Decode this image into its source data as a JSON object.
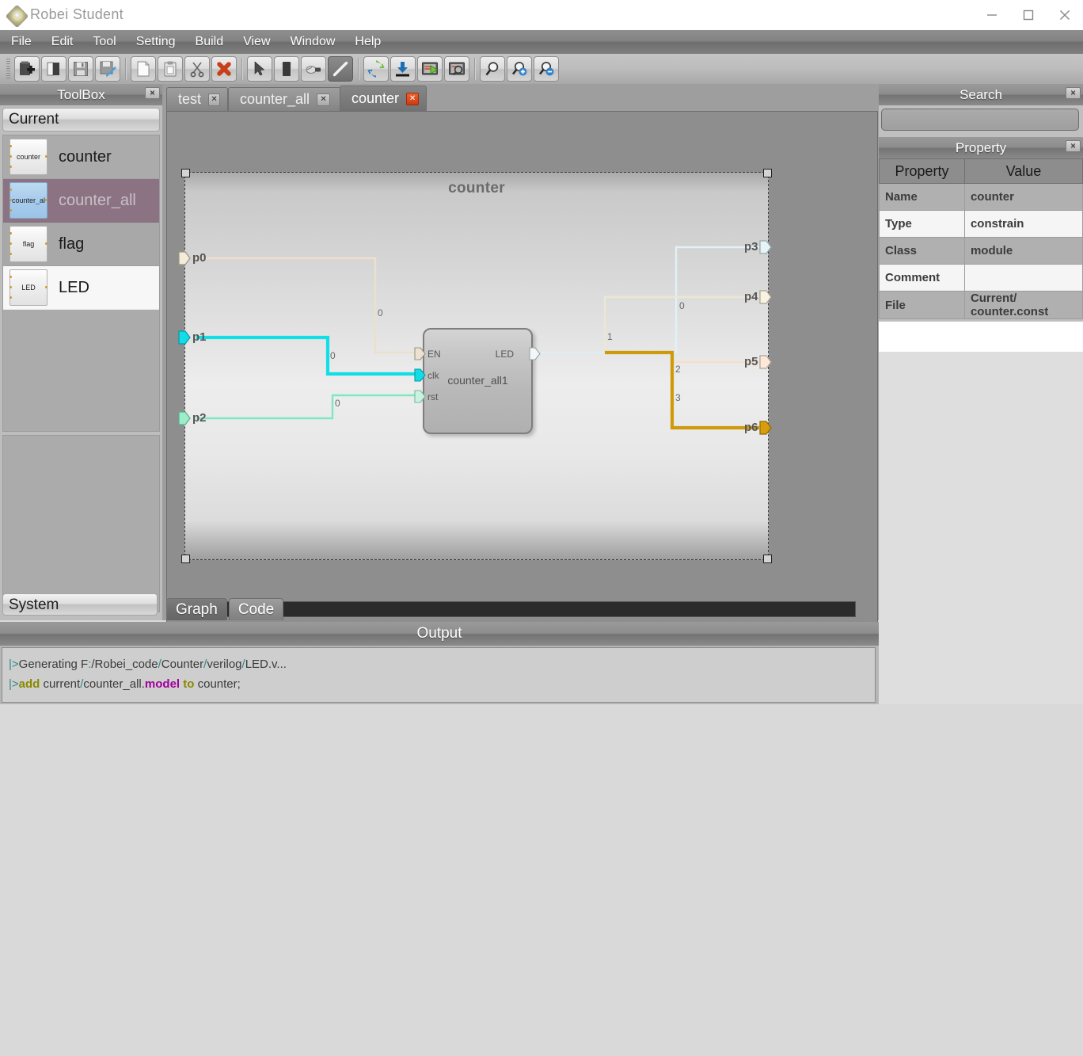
{
  "window": {
    "title": "Robei  Student",
    "app_icon": "robei-logo-icon",
    "minimize": "minimize-icon",
    "maximize": "maximize-icon",
    "close": "close-icon"
  },
  "menubar": {
    "items": [
      "File",
      "Edit",
      "Tool",
      "Setting",
      "Build",
      "View",
      "Window",
      "Help"
    ]
  },
  "toolbar": {
    "groups": [
      {
        "buttons": [
          {
            "name": "new-project-icon",
            "title": "New"
          },
          {
            "name": "open-book-icon",
            "title": "Open"
          },
          {
            "name": "save-icon",
            "title": "Save"
          },
          {
            "name": "save-as-icon",
            "title": "Save As"
          }
        ]
      },
      {
        "buttons": [
          {
            "name": "copy-page-icon",
            "title": "Copy"
          },
          {
            "name": "paste-clipboard-icon",
            "title": "Paste"
          },
          {
            "name": "cut-scissors-icon",
            "title": "Cut"
          },
          {
            "name": "delete-x-icon",
            "title": "Delete"
          }
        ]
      },
      {
        "buttons": [
          {
            "name": "select-arrow-icon",
            "title": "Select"
          },
          {
            "name": "module-icon",
            "title": "Module"
          },
          {
            "name": "port-plug-icon",
            "title": "Port"
          },
          {
            "name": "wire-pen-icon",
            "title": "Wire",
            "active": true
          }
        ]
      },
      {
        "buttons": [
          {
            "name": "compile-refresh-icon",
            "title": "Compile"
          },
          {
            "name": "download-icon",
            "title": "Download"
          },
          {
            "name": "run-simulation-icon",
            "title": "Run"
          },
          {
            "name": "inspect-waveform-icon",
            "title": "Inspect"
          }
        ]
      },
      {
        "buttons": [
          {
            "name": "zoom-fit-icon",
            "title": "Zoom Fit"
          },
          {
            "name": "zoom-in-icon",
            "title": "Zoom In"
          },
          {
            "name": "zoom-out-icon",
            "title": "Zoom Out"
          }
        ]
      }
    ]
  },
  "toolbox": {
    "title": "ToolBox",
    "close_icon": "close-icon",
    "group_current": "Current",
    "group_system": "System",
    "items": [
      {
        "chip": "counter",
        "label": "counter",
        "state": "normal"
      },
      {
        "chip": "counter_al",
        "label": "counter_all",
        "state": "selected"
      },
      {
        "chip": "flag",
        "label": "flag",
        "state": "normal"
      },
      {
        "chip": "LED",
        "label": "LED",
        "state": "white"
      }
    ]
  },
  "editor": {
    "tabs": [
      {
        "label": "test",
        "active": false,
        "close_icon": "close-icon"
      },
      {
        "label": "counter_all",
        "active": false,
        "close_icon": "close-icon"
      },
      {
        "label": "counter",
        "active": true,
        "close_icon": "close-icon"
      }
    ],
    "bottom_tabs": [
      {
        "label": "Graph",
        "active": true
      },
      {
        "label": "Code",
        "active": false
      }
    ]
  },
  "schematic": {
    "module_title": "counter",
    "block": {
      "name": "counter_all1",
      "inputs": [
        {
          "label": "EN",
          "color": "#e8dfcf"
        },
        {
          "label": "clk",
          "color": "#1fd8e0"
        },
        {
          "label": "rst",
          "color": "#bdf0dd"
        }
      ],
      "outputs": [
        {
          "label": "LED",
          "color": "#eef4f4"
        }
      ]
    },
    "input_ports": [
      {
        "label": "p0",
        "color": "#f2e9d8",
        "wire_label": "0"
      },
      {
        "label": "p1",
        "color": "#12e2ea",
        "wire_label": "0"
      },
      {
        "label": "p2",
        "color": "#9aeec9",
        "wire_label": "0"
      }
    ],
    "output_ports": [
      {
        "label": "p3",
        "color": "#e8f4f6",
        "wire_label": "0"
      },
      {
        "label": "p4",
        "color": "#f6f1e0",
        "wire_label": "1"
      },
      {
        "label": "p5",
        "color": "#fbe7d8",
        "wire_label": "2"
      },
      {
        "label": "p6",
        "color": "#d59a0c",
        "wire_label": "3"
      }
    ]
  },
  "search": {
    "title": "Search",
    "close_icon": "close-icon",
    "value": "",
    "placeholder": ""
  },
  "property": {
    "title": "Property",
    "close_icon": "close-icon",
    "headers": [
      "Property",
      "Value"
    ],
    "rows": [
      {
        "key": "Name",
        "value": "counter"
      },
      {
        "key": "Type",
        "value": "constrain"
      },
      {
        "key": "Class",
        "value": "module"
      },
      {
        "key": "Comment",
        "value": ""
      },
      {
        "key": "File",
        "value": "Current/ counter.const"
      }
    ]
  },
  "output": {
    "title": "Output",
    "lines": [
      [
        {
          "t": "|>",
          "c": "c-pipe"
        },
        {
          "t": "Generating F",
          "c": "c-plain"
        },
        {
          "t": ":",
          "c": "c-path"
        },
        {
          "t": "/Robei_code",
          "c": "c-plain"
        },
        {
          "t": "/",
          "c": "c-path"
        },
        {
          "t": "Counter",
          "c": "c-plain"
        },
        {
          "t": "/",
          "c": "c-path"
        },
        {
          "t": "verilog",
          "c": "c-plain"
        },
        {
          "t": "/",
          "c": "c-path"
        },
        {
          "t": "LED.v...",
          "c": "c-plain"
        }
      ],
      [
        {
          "t": "|>",
          "c": "c-pipe"
        },
        {
          "t": "add",
          "c": "c-key"
        },
        {
          "t": " current",
          "c": "c-plain"
        },
        {
          "t": "/",
          "c": "c-path"
        },
        {
          "t": "counter_all.",
          "c": "c-plain"
        },
        {
          "t": "model",
          "c": "c-mag"
        },
        {
          "t": " to",
          "c": "c-key"
        },
        {
          "t": " counter;",
          "c": "c-plain"
        }
      ]
    ]
  }
}
